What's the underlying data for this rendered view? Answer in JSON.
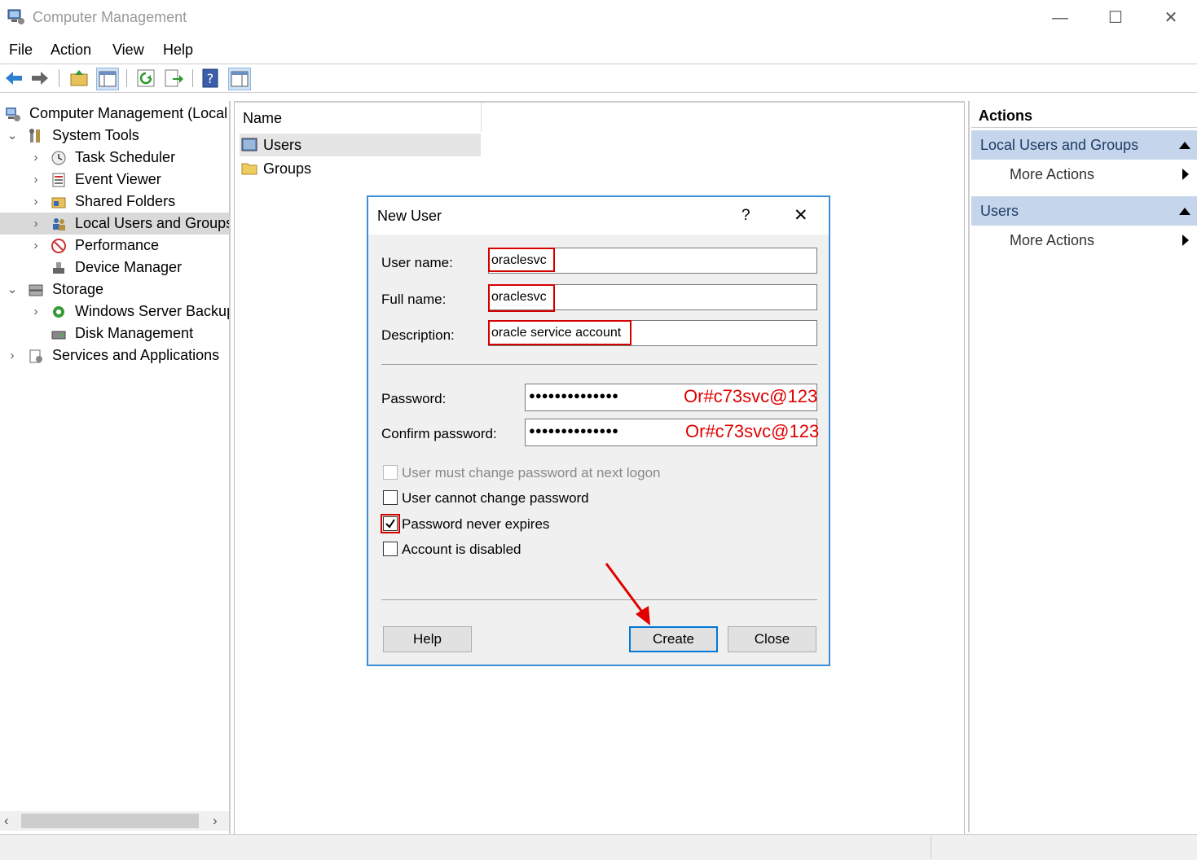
{
  "window": {
    "title": "Computer Management",
    "controls": {
      "minimize": "—",
      "maximize": "☐",
      "close": "✕"
    }
  },
  "menu": [
    "File",
    "Action",
    "View",
    "Help"
  ],
  "tree": {
    "root": "Computer Management (Local",
    "system_tools": "System Tools",
    "task_scheduler": "Task Scheduler",
    "event_viewer": "Event Viewer",
    "shared_folders": "Shared Folders",
    "local_users": "Local Users and Groups",
    "performance": "Performance",
    "device_manager": "Device Manager",
    "storage": "Storage",
    "wsb": "Windows Server Backup",
    "disk_management": "Disk Management",
    "services_apps": "Services and Applications"
  },
  "center": {
    "column": "Name",
    "items": [
      "Users",
      "Groups"
    ]
  },
  "actions": {
    "header": "Actions",
    "section1": "Local Users and Groups",
    "section1_more": "More Actions",
    "section2": "Users",
    "section2_more": "More Actions"
  },
  "dialog": {
    "title": "New User",
    "help_glyph": "?",
    "close_glyph": "✕",
    "username_label": "User name:",
    "username_value": "oraclesvc",
    "fullname_label": "Full name:",
    "fullname_value": "oraclesvc",
    "description_label": "Description:",
    "description_value": "oracle service account",
    "password_label": "Password:",
    "password_mask": "●●●●●●●●●●●●●●",
    "password_annotation": "Or#c73svc@123",
    "confirm_label": "Confirm password:",
    "confirm_mask": "●●●●●●●●●●●●●●",
    "confirm_annotation": "Or#c73svc@123",
    "cb_must_change": "User must change password at next logon",
    "cb_cannot_change": "User cannot change password",
    "cb_never_expires": "Password never expires",
    "cb_disabled": "Account is disabled",
    "checks": {
      "must_change": false,
      "cannot_change": false,
      "never_expires": true,
      "disabled": false
    },
    "help_button": "Help",
    "create_button": "Create",
    "close_button": "Close"
  },
  "colors": {
    "accent": "#0078d7",
    "annotation_red": "#e00000",
    "section_bg": "#c5d6ec"
  }
}
